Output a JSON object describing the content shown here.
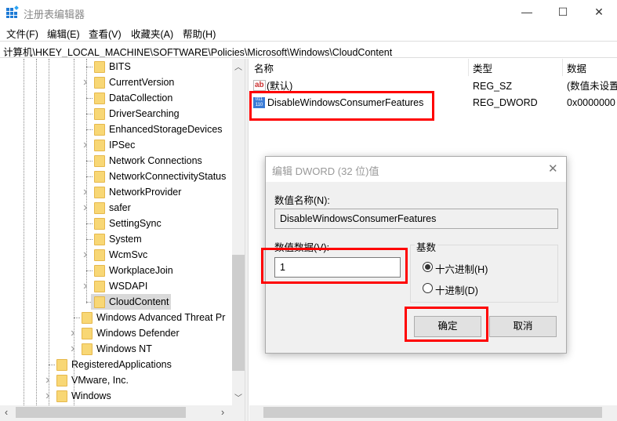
{
  "window": {
    "title": "注册表编辑器",
    "minimize": "—",
    "maximize": "☐",
    "close": "✕"
  },
  "menu": [
    "文件(F)",
    "编辑(E)",
    "查看(V)",
    "收藏夹(A)",
    "帮助(H)"
  ],
  "address": "计算机\\HKEY_LOCAL_MACHINE\\SOFTWARE\\Policies\\Microsoft\\Windows\\CloudContent",
  "tree": [
    {
      "label": "BITS",
      "level": 3,
      "expandable": false
    },
    {
      "label": "CurrentVersion",
      "level": 3,
      "expandable": true
    },
    {
      "label": "DataCollection",
      "level": 3,
      "expandable": false
    },
    {
      "label": "DriverSearching",
      "level": 3,
      "expandable": false
    },
    {
      "label": "EnhancedStorageDevices",
      "level": 3,
      "expandable": false
    },
    {
      "label": "IPSec",
      "level": 3,
      "expandable": true
    },
    {
      "label": "Network Connections",
      "level": 3,
      "expandable": false
    },
    {
      "label": "NetworkConnectivityStatus",
      "level": 3,
      "expandable": false
    },
    {
      "label": "NetworkProvider",
      "level": 3,
      "expandable": true
    },
    {
      "label": "safer",
      "level": 3,
      "expandable": true
    },
    {
      "label": "SettingSync",
      "level": 3,
      "expandable": false
    },
    {
      "label": "System",
      "level": 3,
      "expandable": false
    },
    {
      "label": "WcmSvc",
      "level": 3,
      "expandable": true
    },
    {
      "label": "WorkplaceJoin",
      "level": 3,
      "expandable": false
    },
    {
      "label": "WSDAPI",
      "level": 3,
      "expandable": true
    },
    {
      "label": "CloudContent",
      "level": 3,
      "expandable": false,
      "selected": true
    },
    {
      "label": "Windows Advanced Threat Pr",
      "level": 2,
      "expandable": false
    },
    {
      "label": "Windows Defender",
      "level": 2,
      "expandable": true
    },
    {
      "label": "Windows NT",
      "level": 2,
      "expandable": true
    },
    {
      "label": "RegisteredApplications",
      "level": 1,
      "expandable": false
    },
    {
      "label": "VMware, Inc.",
      "level": 1,
      "expandable": true
    },
    {
      "label": "Windows",
      "level": 1,
      "expandable": true
    }
  ],
  "values": {
    "headers": {
      "name": "名称",
      "type": "类型",
      "data": "数据"
    },
    "rows": [
      {
        "icon": "ab-string-icon",
        "name": "(默认)",
        "type": "REG_SZ",
        "data": "(数值未设置"
      },
      {
        "icon": "binary-value-icon",
        "name": "DisableWindowsConsumerFeatures",
        "type": "REG_DWORD",
        "data": "0x0000000"
      }
    ]
  },
  "dialog": {
    "title": "编辑 DWORD (32 位)值",
    "name_label": "数值名称(N):",
    "name_value": "DisableWindowsConsumerFeatures",
    "data_label": "数值数据(V):",
    "data_value": "1",
    "base_label": "基数",
    "hex_label": "十六进制(H)",
    "dec_label": "十进制(D)",
    "selected_base": "hex",
    "ok": "确定",
    "cancel": "取消"
  },
  "highlight_color": "#ff0000"
}
